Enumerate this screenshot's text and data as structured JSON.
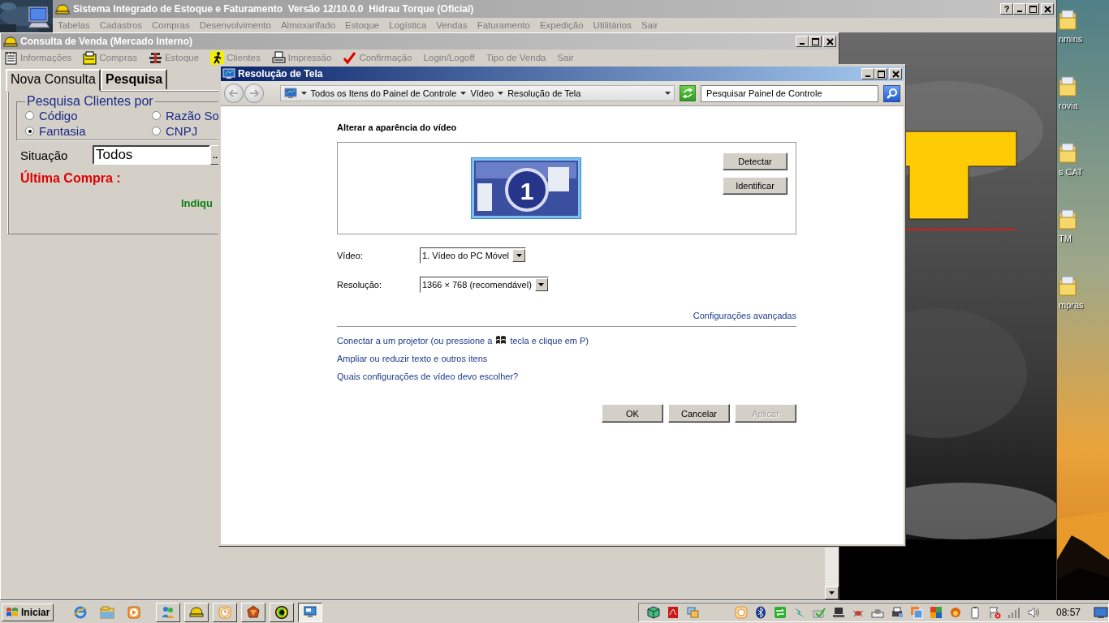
{
  "main_window": {
    "title": "Sistema Integrado de Estoque e Faturamento  Versão 12/10.0.0  Hidrau Torque (Oficial)",
    "help": "?",
    "menu": [
      "Tabelas",
      "Cadastros",
      "Compras",
      "Desenvolvimento",
      "Almoxarifado",
      "Estoque",
      "Logística",
      "Vendas",
      "Faturamento",
      "Expedição",
      "Utilitários",
      "Sair"
    ]
  },
  "child_window": {
    "title": "Consulta de Venda (Mercado Interno)",
    "toolbar": [
      "Informações",
      "Compras",
      "Estoque",
      "Clientes",
      "Impressão",
      "Confirmação",
      "Login/Logoff",
      "Tipo de Venda",
      "Sair"
    ],
    "tabs": [
      {
        "label": "Nova Consulta",
        "selected": true
      },
      {
        "label": "Pesquisa",
        "selected": false
      }
    ],
    "search_by": {
      "legend": "Pesquisa Clientes por",
      "options": [
        {
          "label": "Código",
          "selected": false
        },
        {
          "label": "Razão So",
          "selected": false
        },
        {
          "label": "Fantasia",
          "selected": true
        },
        {
          "label": "CNPJ",
          "selected": false
        }
      ]
    },
    "status": {
      "label": "Situação",
      "value": "Todos",
      "button": ".."
    },
    "last_purchase": "Última Compra :",
    "hint": "Indiqu"
  },
  "dialog": {
    "title": "Resolução de Tela",
    "breadcrumb": [
      "Todos os Itens do Painel de Controle",
      "Vídeo",
      "Resolução de Tela"
    ],
    "search": {
      "placeholder": "Pesquisar Painel de Controle"
    },
    "heading": "Alterar a aparência do vídeo",
    "monitor_number": "1",
    "side_buttons": [
      "Detectar",
      "Identificar"
    ],
    "fields": [
      {
        "label": "Vídeo:",
        "value": "1. Vídeo do PC Móvel"
      },
      {
        "label": "Resolução:",
        "value": "1366 × 768 (recomendável)"
      }
    ],
    "advanced_link": "Configurações avançadas",
    "projector_link": {
      "before": "Conectar a um projetor (ou pressione a",
      "after": "tecla e clique em P)"
    },
    "links": [
      "Ampliar ou reduzir texto e outros itens",
      "Quais configurações de vídeo devo escolher?"
    ],
    "buttons": [
      {
        "label": "OK",
        "disabled": false
      },
      {
        "label": "Cancelar",
        "disabled": false
      },
      {
        "label": "Aplicar",
        "disabled": true
      }
    ]
  },
  "desktop_icons": [
    "nmins",
    "rovia",
    "s CAT",
    "TM",
    "mpras"
  ],
  "taskbar": {
    "start": "Iniciar",
    "tasks": [
      {
        "selected": false
      },
      {
        "selected": false
      },
      {
        "selected": false
      },
      {
        "selected": false
      },
      {
        "selected": false
      },
      {
        "selected": true
      }
    ],
    "clock": "08:57"
  }
}
